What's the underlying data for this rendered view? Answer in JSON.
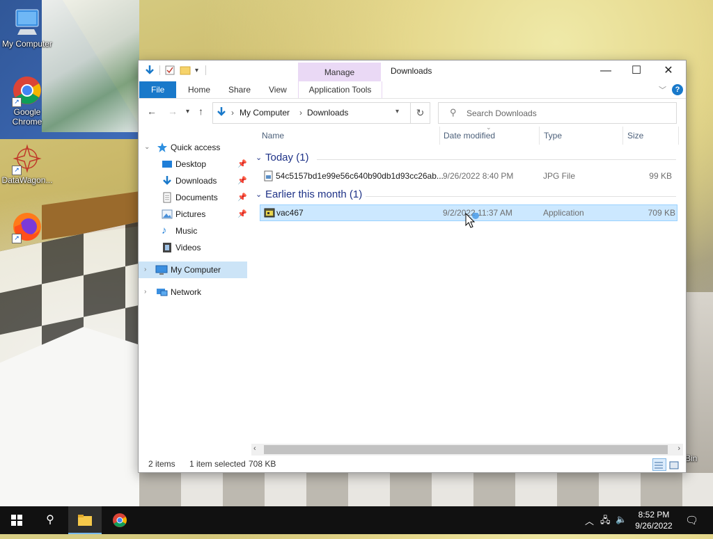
{
  "desktop": {
    "icons": [
      {
        "label": "My Computer",
        "icon": "monitor-icon"
      },
      {
        "label": "Google Chrome",
        "icon": "chrome-icon"
      },
      {
        "label": "DataWagon...",
        "icon": "datawagon-icon"
      },
      {
        "label": "",
        "icon": "firefox-icon"
      }
    ],
    "partial_label_right": "Bin"
  },
  "window": {
    "title": "Downloads",
    "manage_label": "Manage",
    "ribbon_tabs": {
      "file": "File",
      "home": "Home",
      "share": "Share",
      "view": "View",
      "app_tools": "Application Tools"
    },
    "breadcrumb": [
      "My Computer",
      "Downloads"
    ],
    "search_placeholder": "Search Downloads"
  },
  "nav": {
    "quick_access": "Quick access",
    "items": [
      {
        "label": "Desktop",
        "pinned": true
      },
      {
        "label": "Downloads",
        "pinned": true
      },
      {
        "label": "Documents",
        "pinned": true
      },
      {
        "label": "Pictures",
        "pinned": true
      },
      {
        "label": "Music",
        "pinned": false
      },
      {
        "label": "Videos",
        "pinned": false
      }
    ],
    "my_computer": "My Computer",
    "network": "Network"
  },
  "columns": {
    "name": "Name",
    "date": "Date modified",
    "type": "Type",
    "size": "Size"
  },
  "groups": [
    {
      "title": "Today (1)",
      "files": [
        {
          "name": "54c5157bd1e99e56c640b90db1d93cc26ab...",
          "date": "9/26/2022 8:40 PM",
          "type": "JPG File",
          "size": "99 KB",
          "selected": false
        }
      ]
    },
    {
      "title": "Earlier this month (1)",
      "files": [
        {
          "name": "vac467",
          "date": "9/2/2022 11:37 AM",
          "type": "Application",
          "size": "709 KB",
          "selected": true
        }
      ]
    }
  ],
  "status": {
    "items": "2 items",
    "selected": "1 item selected",
    "size": "708 KB"
  },
  "taskbar": {
    "time": "8:52 PM",
    "date": "9/26/2022"
  },
  "colors": {
    "accent": "#1979ca",
    "selection": "#cce8ff",
    "manage_tab": "#ead9f5",
    "taskbar": "#111111"
  }
}
